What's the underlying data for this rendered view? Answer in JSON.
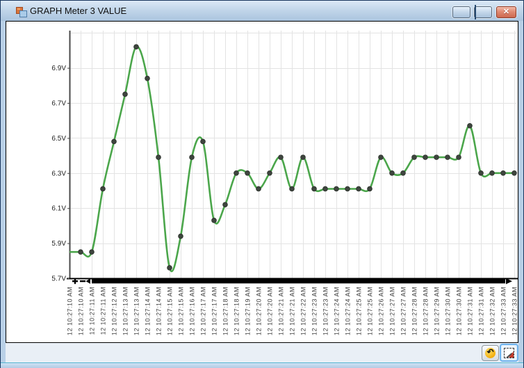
{
  "window": {
    "title": "GRAPH Meter 3 VALUE",
    "icons": {
      "app_icon": "winforms-app-icon",
      "minimize_icon": "minimize-dash",
      "maximize_icon": "maximize-square",
      "close_icon": "✕",
      "reset_zoom_icon": "↶",
      "selection_icon": "dashed-marquee"
    }
  },
  "scrollbar": {
    "zoom_in": "+",
    "zoom_out": "−",
    "left_arrow": "◄",
    "right_arrow": "►"
  },
  "chart_data": {
    "type": "line",
    "title": "GRAPH Meter 3 VALUE",
    "line_style": "spline",
    "grid": true,
    "legend": "none",
    "ylim": [
      5.7,
      7.1
    ],
    "y_gridline_top": 7.1,
    "y_ticks": [
      {
        "value": 5.7,
        "label": "5.7V"
      },
      {
        "value": 5.9,
        "label": "5.9V"
      },
      {
        "value": 6.1,
        "label": "6.1V"
      },
      {
        "value": 6.3,
        "label": "6.3V"
      },
      {
        "value": 6.5,
        "label": "6.5V"
      },
      {
        "value": 6.7,
        "label": "6.7V"
      },
      {
        "value": 6.9,
        "label": "6.9V"
      }
    ],
    "x": [
      "12 10:27:10 AM",
      "12 10:27:10 AM",
      "12 10:27:11 AM",
      "12 10:27:11 AM",
      "12 10:27:12 AM",
      "12 10:27:13 AM",
      "12 10:27:13 AM",
      "12 10:27:14 AM",
      "12 10:27:14 AM",
      "12 10:27:15 AM",
      "12 10:27:15 AM",
      "12 10:27:16 AM",
      "12 10:27:17 AM",
      "12 10:27:17 AM",
      "12 10:27:18 AM",
      "12 10:27:18 AM",
      "12 10:27:19 AM",
      "12 10:27:20 AM",
      "12 10:27:20 AM",
      "12 10:27:21 AM",
      "12 10:27:21 AM",
      "12 10:27:22 AM",
      "12 10:27:23 AM",
      "12 10:27:23 AM",
      "12 10:27:24 AM",
      "12 10:27:24 AM",
      "12 10:27:25 AM",
      "12 10:27:25 AM",
      "12 10:27:26 AM",
      "12 10:27:27 AM",
      "12 10:27:27 AM",
      "12 10:27:28 AM",
      "12 10:27:28 AM",
      "12 10:27:29 AM",
      "12 10:27:30 AM",
      "12 10:27:30 AM",
      "12 10:27:31 AM",
      "12 10:27:31 AM",
      "12 10:27:32 AM",
      "12 10:27:33 AM",
      "12 10:27:33 AM"
    ],
    "series": [
      {
        "name": "Meter 3 VALUE",
        "values": [
          5.85,
          5.85,
          5.85,
          6.21,
          6.48,
          6.75,
          7.02,
          6.84,
          6.39,
          5.76,
          5.94,
          6.39,
          6.48,
          6.03,
          6.12,
          6.3,
          6.3,
          6.21,
          6.3,
          6.39,
          6.21,
          6.39,
          6.21,
          6.21,
          6.21,
          6.21,
          6.21,
          6.21,
          6.39,
          6.3,
          6.3,
          6.39,
          6.39,
          6.39,
          6.39,
          6.39,
          6.57,
          6.3,
          6.3,
          6.3,
          6.3
        ]
      }
    ],
    "colors": {
      "line": "#4BA64B",
      "marker": "#3E453E",
      "grid": "#E3E3E3",
      "x_axis": "#000000",
      "y_axis": "#4A4A4A",
      "label": "#3F3F3F"
    }
  }
}
